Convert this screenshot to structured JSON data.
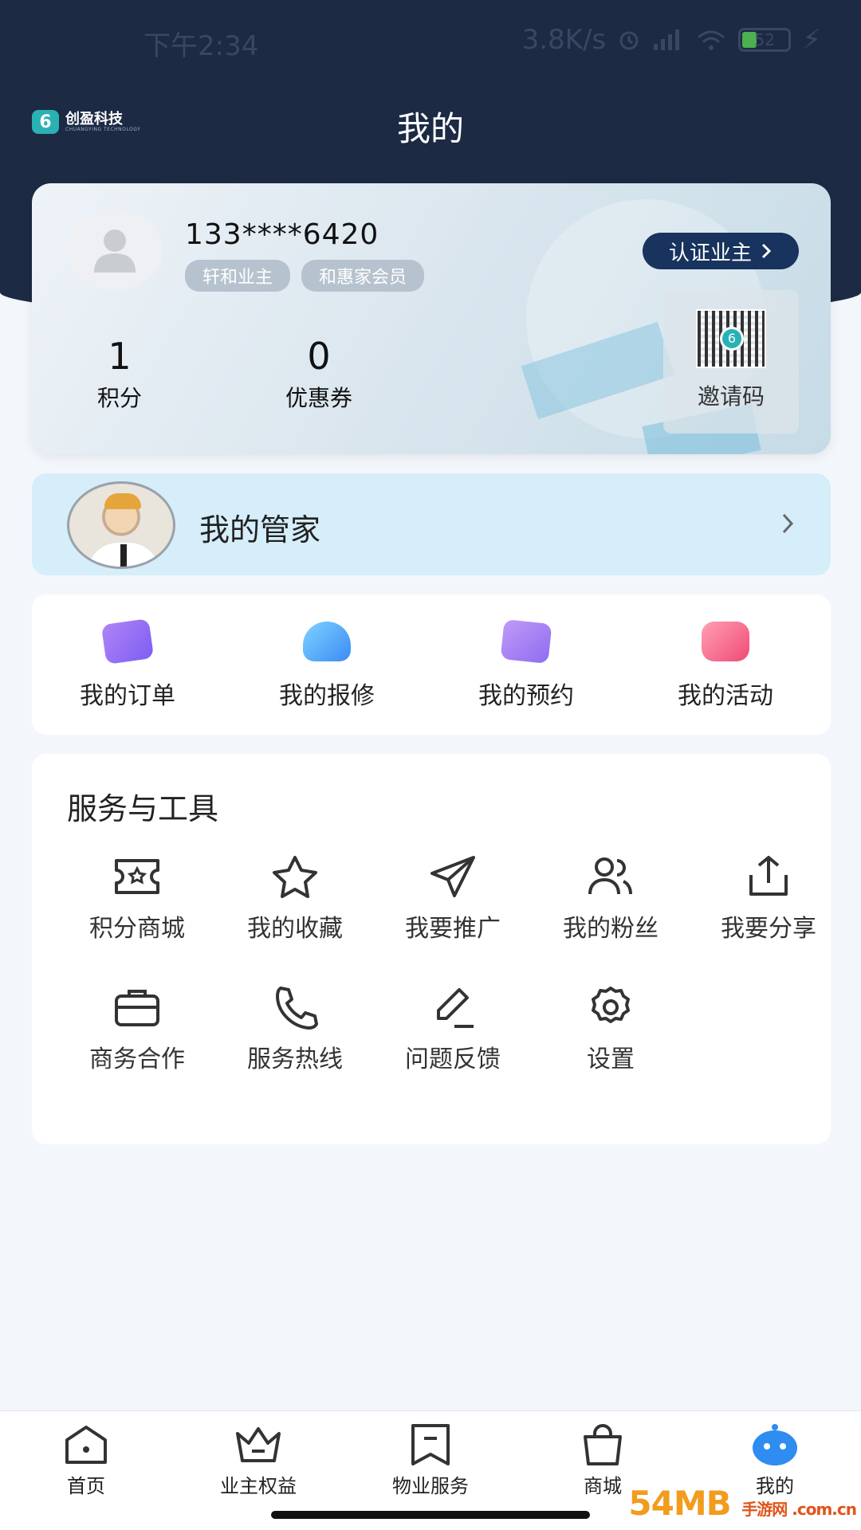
{
  "status_bar": {
    "time": "下午2:34",
    "network_speed": "3.8K/s",
    "battery": "52"
  },
  "brand": {
    "name": "创盈科技",
    "subtitle": "CHUANGYING TECHNOLOGY"
  },
  "page": {
    "title": "我的"
  },
  "profile": {
    "phone": "133****6420",
    "tags": [
      "轩和业主",
      "和惠家会员"
    ],
    "verify_label": "认证业主",
    "stats": [
      {
        "value": "1",
        "label": "积分"
      },
      {
        "value": "0",
        "label": "优惠券"
      }
    ],
    "invite_label": "邀请码"
  },
  "butler": {
    "label": "我的管家"
  },
  "quick_actions": [
    {
      "label": "我的订单",
      "icon": "order-icon"
    },
    {
      "label": "我的报修",
      "icon": "repair-icon"
    },
    {
      "label": "我的预约",
      "icon": "booking-icon"
    },
    {
      "label": "我的活动",
      "icon": "activity-icon"
    }
  ],
  "tools": {
    "title": "服务与工具",
    "items": [
      {
        "label": "积分商城",
        "icon": "ticket-icon"
      },
      {
        "label": "我的收藏",
        "icon": "star-icon"
      },
      {
        "label": "我要推广",
        "icon": "send-icon"
      },
      {
        "label": "我的粉丝",
        "icon": "users-icon"
      },
      {
        "label": "我要分享",
        "icon": "share-icon"
      },
      {
        "label": "商务合作",
        "icon": "briefcase-icon"
      },
      {
        "label": "服务热线",
        "icon": "phone-icon"
      },
      {
        "label": "问题反馈",
        "icon": "edit-icon"
      },
      {
        "label": "设置",
        "icon": "gear-icon"
      }
    ]
  },
  "tabbar": [
    {
      "label": "首页",
      "icon": "home-icon"
    },
    {
      "label": "业主权益",
      "icon": "crown-icon"
    },
    {
      "label": "物业服务",
      "icon": "bookmark-icon"
    },
    {
      "label": "商城",
      "icon": "bag-icon"
    },
    {
      "label": "我的",
      "icon": "robot-icon",
      "active": true
    }
  ],
  "watermark": {
    "text": "54MB",
    "sub": "手游网 .com.cn"
  },
  "colors": {
    "header": "#1c2a44",
    "verify_button": "#17335e",
    "butler_bg": "#d5eef9",
    "accent_teal": "#2ab1b4"
  }
}
